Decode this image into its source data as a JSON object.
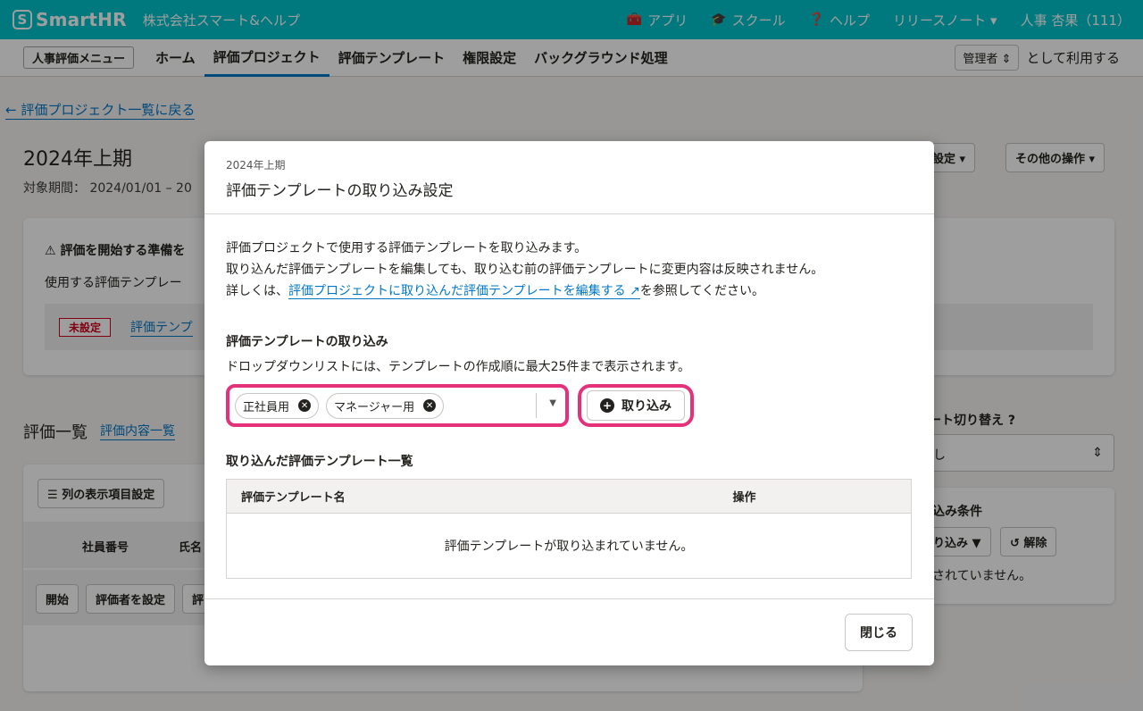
{
  "header": {
    "logo": "SmartHR",
    "company": "株式会社スマート&ヘルプ",
    "nav": [
      {
        "icon": "toolbox-icon",
        "label": "アプリ"
      },
      {
        "icon": "graduation-cap-icon",
        "label": "スクール"
      },
      {
        "icon": "help-circle-icon",
        "label": "ヘルプ"
      },
      {
        "icon": "",
        "label": "リリースノート ▾"
      }
    ],
    "user": "人事 杏果（111）"
  },
  "subnav": {
    "menu": "人事評価メニュー",
    "tabs": [
      "ホーム",
      "評価プロジェクト",
      "評価テンプレート",
      "権限設定",
      "バックグラウンド処理"
    ],
    "active_tab": "評価プロジェクト",
    "role_value": "管理者",
    "role_suffix": "として利用する"
  },
  "page": {
    "back": "評価プロジェクト一覧に戻る",
    "title": "2024年上期",
    "period": "対象期間： 2024/01/01 – 20",
    "btn_mail": "ル設定 ▾",
    "btn_other": "その他の操作 ▾",
    "notice_title": "評価を開始する準備を",
    "notice_body": "使用する評価テンプレー",
    "badge": "未設定",
    "badge_link": "評価テンプ",
    "list_title": "評価一覧",
    "list_link": "評価内容一覧",
    "col_btn": "列の表示項目設定",
    "col_emp": "社員番号",
    "col_name": "氏名",
    "act_start": "開始",
    "act_set": "評価者を設定",
    "act_more": "評",
    "side_label": "ート切り替え",
    "side_select": "し",
    "side_cond": "込み条件",
    "side_filter": "り込み",
    "side_clear": "解除",
    "side_empty": "されていません。"
  },
  "modal": {
    "subtitle": "2024年上期",
    "title": "評価テンプレートの取り込み設定",
    "desc1": "評価プロジェクトで使用する評価テンプレートを取り込みます。",
    "desc2": "取り込んだ評価テンプレートを編集しても、取り込む前の評価テンプレートに変更内容は反映されません。",
    "desc3_pre": "詳しくは、",
    "desc3_link": "評価プロジェクトに取り込んだ評価テンプレートを編集する",
    "desc3_post": "を参照してください。",
    "import_title": "評価テンプレートの取り込み",
    "import_desc": "ドロップダウンリストには、テンプレートの作成順に最大25件まで表示されます。",
    "chips": [
      "正社員用",
      "マネージャー用"
    ],
    "import_button": "取り込み",
    "list_title": "取り込んだ評価テンプレート一覧",
    "col_name": "評価テンプレート名",
    "col_action": "操作",
    "empty": "評価テンプレートが取り込まれていません。",
    "close": "閉じる"
  },
  "colors": {
    "brand": "#00c4cc",
    "link": "#0077c7",
    "highlight": "#e4317a"
  }
}
